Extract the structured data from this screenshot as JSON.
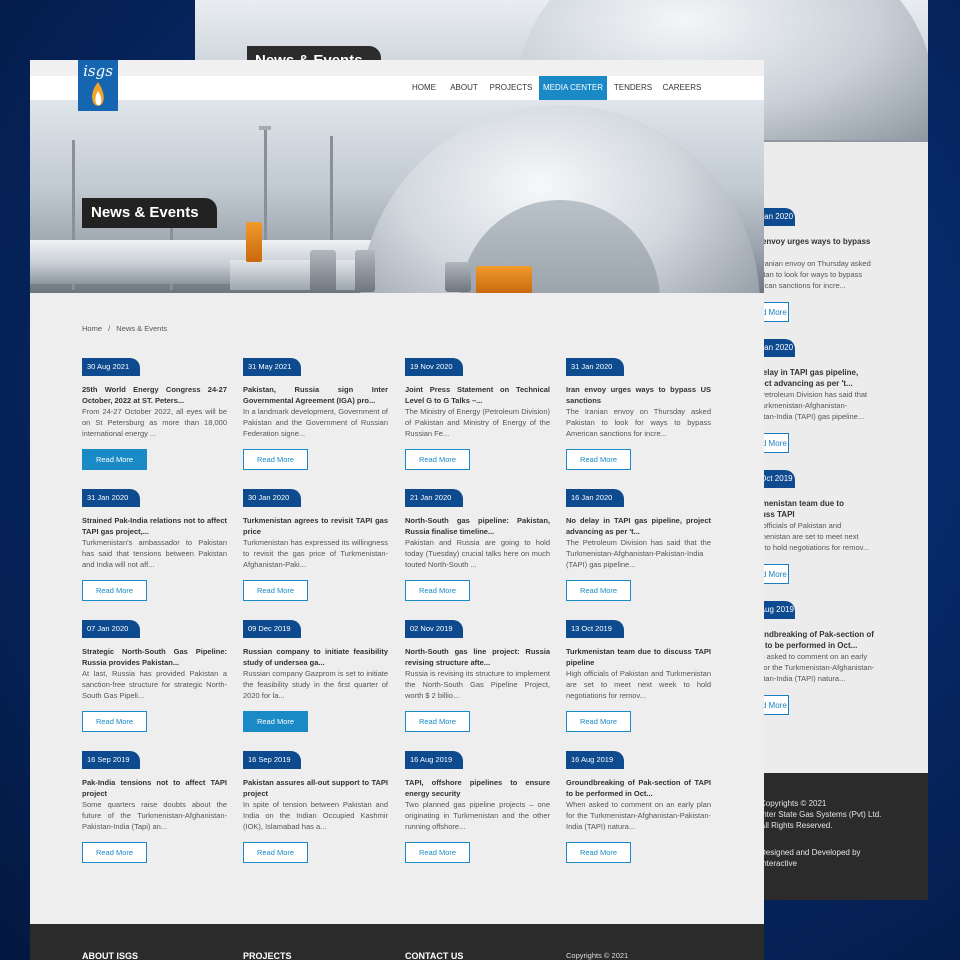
{
  "back_page": {
    "badge": "News & Events",
    "cards": [
      {
        "date": "31 Jan 2020",
        "title": "Iran envoy urges ways to bypass US",
        "excerpt": "The Iranian envoy on Thursday asked Pakistan to look for ways to bypass American sanctions for incre...",
        "button": "Read More"
      },
      {
        "date": "16 Jan 2020",
        "title": "No delay in TAPI gas pipeline, project advancing as per 't...",
        "excerpt": "The Petroleum Division has said that the Turkmenistan-Afghanistan-Pakistan-India (TAPI) gas pipeline...",
        "button": "Read More"
      },
      {
        "date": "13 Oct 2019",
        "title": "Turkmenistan team due to discuss TAPI",
        "excerpt": "High officials of Pakistan and Turkmenistan are set to meet next week to hold negotiations for remov...",
        "button": "Read More"
      },
      {
        "date": "16 Aug 2019",
        "title": "Groundbreaking of Pak-section of TAPI to be performed in Oct...",
        "excerpt": "When asked to comment on an early plan for the Turkmenistan-Afghanistan-Pakistan-India (TAPI) natura...",
        "button": "Read More"
      }
    ],
    "footer_lines": [
      "Copyrights © 2021",
      "Inter State Gas Systems (Pvt) Ltd.",
      "All Rights Reserved.",
      "Designed and Developed by",
      "Interactive"
    ]
  },
  "brand": {
    "logo_text": "isgs"
  },
  "nav": {
    "items": [
      {
        "label": "HOME",
        "active": false
      },
      {
        "label": "ABOUT",
        "active": false
      },
      {
        "label": "PROJECTS",
        "active": false
      },
      {
        "label": "MEDIA CENTER",
        "active": true
      },
      {
        "label": "TENDERS",
        "active": false
      },
      {
        "label": "CAREERS",
        "active": false
      }
    ]
  },
  "hero": {
    "badge": "News & Events"
  },
  "breadcrumb": {
    "home": "Home",
    "separator": "/",
    "current": "News & Events"
  },
  "news": [
    {
      "date": "30 Aug 2021",
      "title": "25th World Energy Congress 24-27 October, 2022 at ST. Peters...",
      "excerpt": "From 24-27 October 2022, all eyes will be on St Petersburg as more than 18,000 international energy ...",
      "button": "Read More",
      "filled": true
    },
    {
      "date": "31 May 2021",
      "title": "Pakistan, Russia sign Inter Governmental Agreement (IGA) pro...",
      "excerpt": "In a landmark development, Government of Pakistan and the Government of Russian Federation signe...",
      "button": "Read More",
      "filled": false
    },
    {
      "date": "19 Nov 2020",
      "title": "Joint Press Statement on Technical Level G to G Talks –...",
      "excerpt": "The Ministry of Energy (Petroleum Division) of Pakistan and Ministry of Energy of the Russian Fe...",
      "button": "Read More",
      "filled": false
    },
    {
      "date": "31 Jan 2020",
      "title": "Iran envoy urges ways to bypass US sanctions",
      "excerpt": "The Iranian envoy on Thursday asked Pakistan to look for ways to bypass American sanctions for incre...",
      "button": "Read More",
      "filled": false
    },
    {
      "date": "31 Jan 2020",
      "title": "Strained Pak-India relations not to affect TAPI gas project,...",
      "excerpt": "Turkmenistan's ambassador to Pakistan has said that tensions between Pakistan and India will not aff...",
      "button": "Read More",
      "filled": false
    },
    {
      "date": "30 Jan 2020",
      "title": "Turkmenistan agrees to revisit TAPI gas price",
      "excerpt": "Turkmenistan has expressed its willingness to revisit the gas price of Turkmenistan-Afghanistan-Paki...",
      "button": "Read More",
      "filled": false
    },
    {
      "date": "21 Jan 2020",
      "title": "North-South gas pipeline: Pakistan, Russia finalise timeline...",
      "excerpt": "Pakistan and Russia are going to hold today (Tuesday) crucial talks here on much touted North-South ...",
      "button": "Read More",
      "filled": false
    },
    {
      "date": "16 Jan 2020",
      "title": "No delay in TAPI gas pipeline, project advancing as per 't...",
      "excerpt": "The Petroleum Division has said that the Turkmenistan-Afghanistan-Pakistan-India (TAPI) gas pipeline...",
      "button": "Read More",
      "filled": false
    },
    {
      "date": "07 Jan 2020",
      "title": "Strategic North-South Gas Pipeline: Russia provides Pakistan...",
      "excerpt": "At last, Russia has provided Pakistan a sanction-free structure for strategic North-South Gas Pipeli...",
      "button": "Read More",
      "filled": false
    },
    {
      "date": "09 Dec 2019",
      "title": "Russian company to initiate feasibility study of undersea ga...",
      "excerpt": "Russian company Gazprom is set to initiate the feasibility study in the first quarter of 2020 for la...",
      "button": "Read More",
      "filled": true
    },
    {
      "date": "02 Nov 2019",
      "title": "North-South gas line project: Russia revising structure afte...",
      "excerpt": "Russia is revising its structure to implement the North-South Gas Pipeline Project, worth $ 2 billio...",
      "button": "Read More",
      "filled": false
    },
    {
      "date": "13 Oct 2019",
      "title": "Turkmenistan team due to discuss TAPI pipeline",
      "excerpt": "High officials of Pakistan and Turkmenistan are set to meet next week to hold negotiations for remov...",
      "button": "Read More",
      "filled": false
    },
    {
      "date": "16 Sep 2019",
      "title": "Pak-India tensions not to affect TAPI project",
      "excerpt": "Some quarters raise doubts about the future of the Turkmenistan-Afghanistan-Pakistan-India (Tapi) an...",
      "button": "Read More",
      "filled": false
    },
    {
      "date": "16 Sep 2019",
      "title": "Pakistan assures all-out support to TAPI project",
      "excerpt": "In spite of tension between Pakistan and India on the Indian Occupied Kashmir (IOK), Islamabad has a...",
      "button": "Read More",
      "filled": false
    },
    {
      "date": "16 Aug 2019",
      "title": "TAPI, offshore pipelines to ensure energy security",
      "excerpt": "Two planned gas pipeline projects – one originating in Turkmenistan and the other running offshore...",
      "button": "Read More",
      "filled": false
    },
    {
      "date": "16 Aug 2019",
      "title": "Groundbreaking of Pak-section of TAPI to be performed in Oct...",
      "excerpt": "When asked to comment on an early plan for the Turkmenistan-Afghanistan-Pakistan-India (TAPI) natura...",
      "button": "Read More",
      "filled": false
    }
  ],
  "footer": {
    "about_heading": "ABOUT ISGS",
    "projects_heading": "PROJECTS",
    "contact_heading": "CONTACT US",
    "copyright": "Copyrights © 2021"
  },
  "colors": {
    "accent": "#1a8ac6",
    "date_badge": "#0d4a8e",
    "footer": "#2b2b2b",
    "logo": "#1565b0"
  }
}
